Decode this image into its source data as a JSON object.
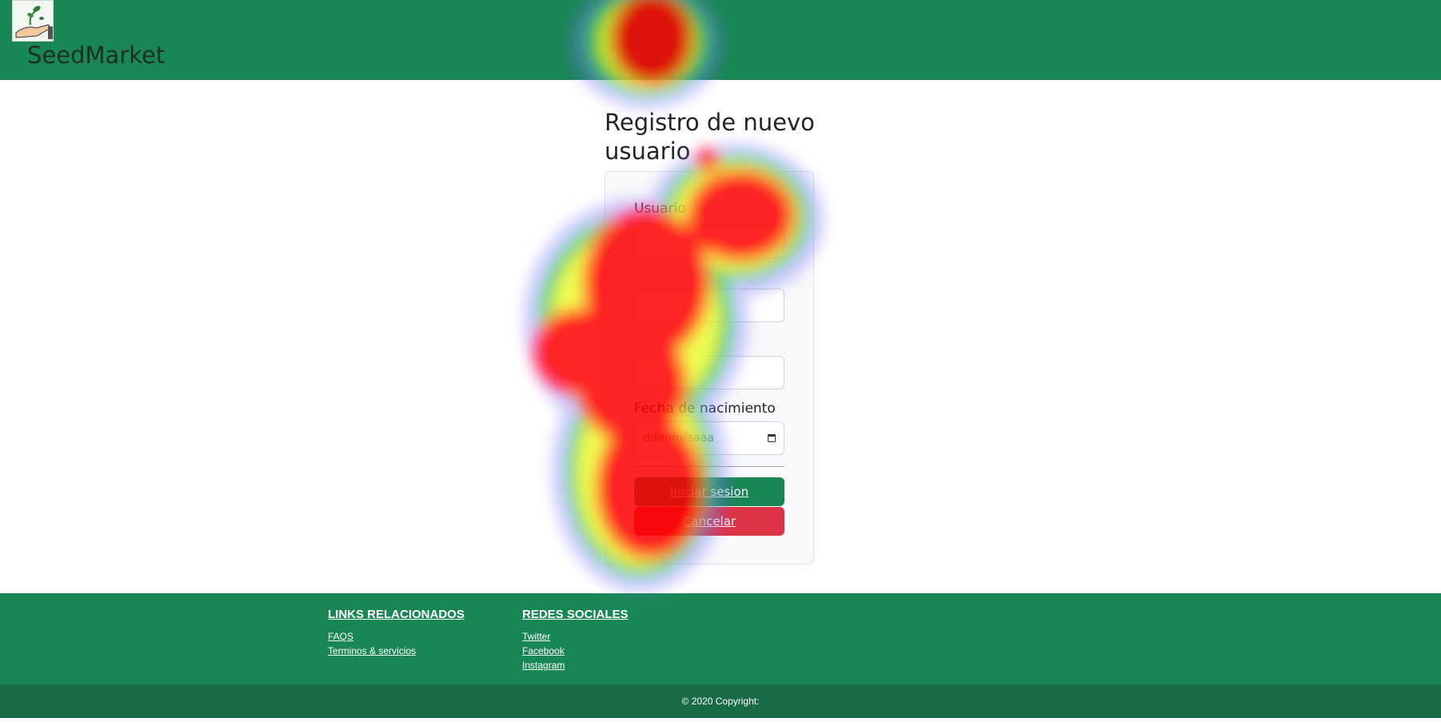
{
  "header": {
    "brand": "SeedMarket",
    "logo_icon": "seedling-hand-icon",
    "background_color": "#198754"
  },
  "main": {
    "title": "Registro de nuevo usuario",
    "form": {
      "fields": [
        {
          "label": "Usuario",
          "placeholder": ""
        },
        {
          "label": "",
          "placeholder": ""
        },
        {
          "label": "",
          "placeholder": ""
        },
        {
          "label": "Fecha de nacimiento",
          "placeholder": "dd/mm/aaaa"
        }
      ],
      "submit_label": "Iniciar sesion",
      "cancel_label": "Cancelar",
      "calendar_icon": "calendar-icon"
    }
  },
  "footer": {
    "links_title": "LINKS RELACIONADOS",
    "links": [
      "FAQS",
      "Terminos & servicios"
    ],
    "social_title": "REDES SOCIALES",
    "social": [
      "Twitter",
      "Facebook",
      "Instagram"
    ],
    "copyright": "© 2020 Copyright:"
  },
  "colors": {
    "primary": "#198754",
    "danger": "#dc3545",
    "footer_bottom": "#176b45"
  }
}
